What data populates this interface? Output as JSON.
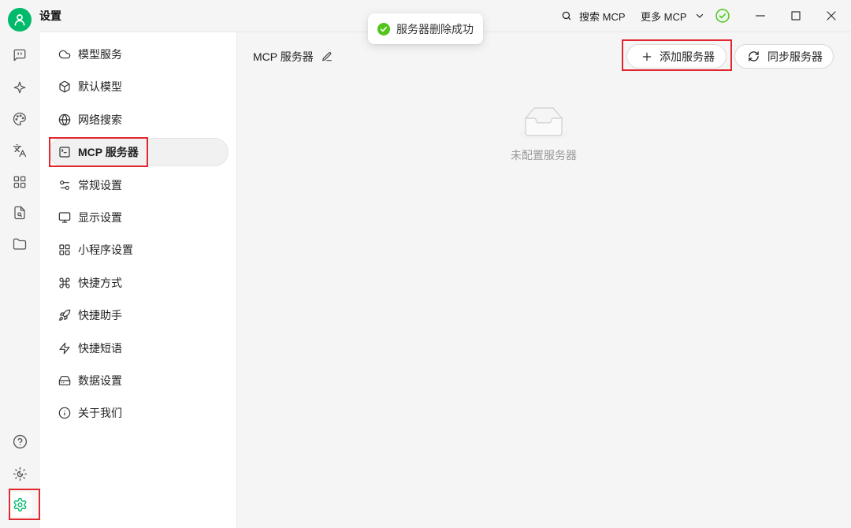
{
  "window": {
    "title": "设置",
    "search_mcp_label": "搜索 MCP",
    "more_mcp_label": "更多 MCP"
  },
  "toast": {
    "message": "服务器删除成功"
  },
  "rail": {
    "top_icons": [
      "chat-icon",
      "sparkle-icon",
      "palette-icon",
      "translate-icon",
      "grid-icon",
      "file-search-icon",
      "folder-icon"
    ],
    "bottom_icons": [
      "help-icon",
      "theme-toggle-icon",
      "settings-icon"
    ],
    "active": "settings-icon"
  },
  "settings_nav": {
    "active_index": 3,
    "items": [
      {
        "label": "模型服务",
        "icon": "cloud-icon"
      },
      {
        "label": "默认模型",
        "icon": "cube-icon"
      },
      {
        "label": "网络搜索",
        "icon": "globe-icon"
      },
      {
        "label": "MCP 服务器",
        "icon": "terminal-icon"
      },
      {
        "label": "常规设置",
        "icon": "sliders-icon"
      },
      {
        "label": "显示设置",
        "icon": "monitor-icon"
      },
      {
        "label": "小程序设置",
        "icon": "grid-icon"
      },
      {
        "label": "快捷方式",
        "icon": "command-icon"
      },
      {
        "label": "快捷助手",
        "icon": "rocket-icon"
      },
      {
        "label": "快捷短语",
        "icon": "zap-icon"
      },
      {
        "label": "数据设置",
        "icon": "hard-drive-icon"
      },
      {
        "label": "关于我们",
        "icon": "info-icon"
      }
    ]
  },
  "main": {
    "title": "MCP 服务器",
    "add_server_label": "添加服务器",
    "sync_servers_label": "同步服务器",
    "empty_text": "未配置服务器"
  },
  "colors": {
    "accent": "#00b96b",
    "success": "#52c41a",
    "highlight_box": "#e0282e"
  }
}
